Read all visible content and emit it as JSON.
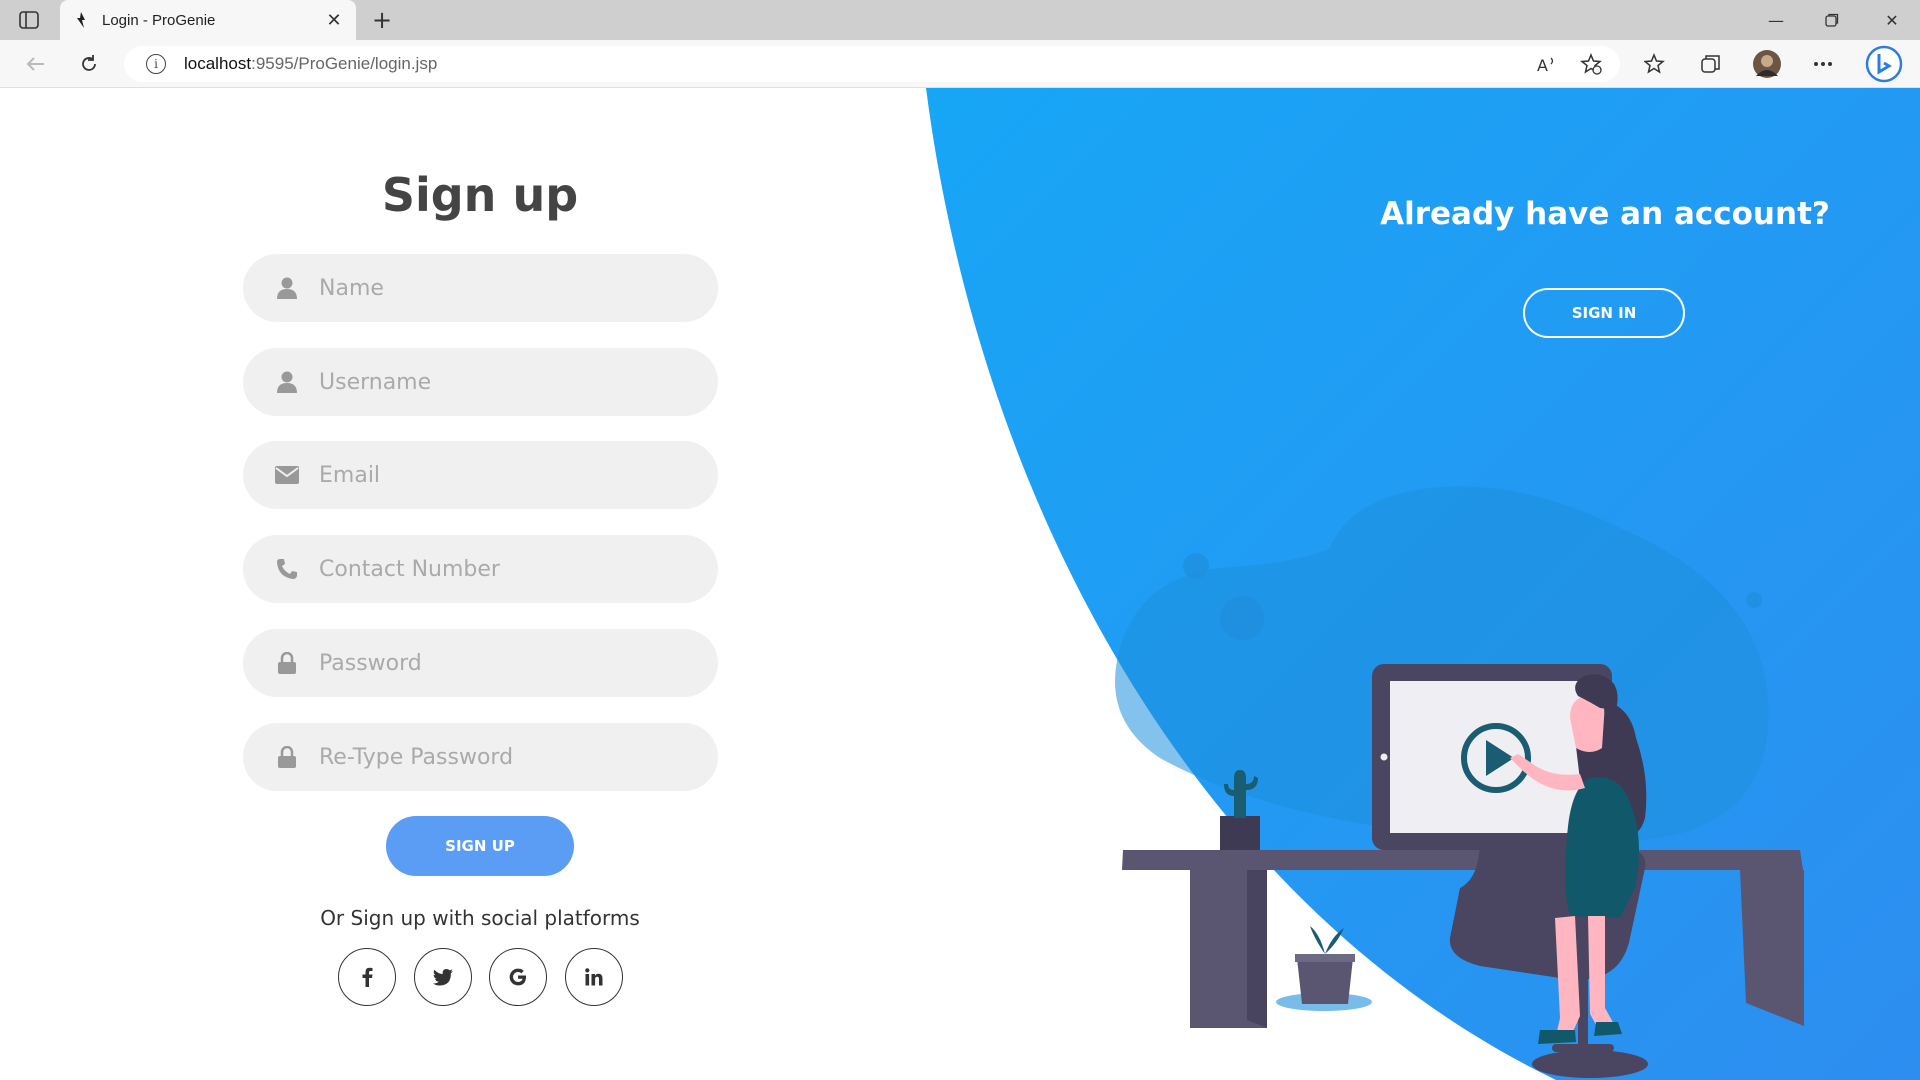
{
  "browser": {
    "tab_title": "Login - ProGenie",
    "url_host": "localhost",
    "url_rest": ":9595/ProGenie/login.jsp"
  },
  "signup": {
    "title": "Sign up",
    "fields": [
      {
        "placeholder": "Name",
        "icon": "user-icon"
      },
      {
        "placeholder": "Username",
        "icon": "user-icon"
      },
      {
        "placeholder": "Email",
        "icon": "envelope-icon"
      },
      {
        "placeholder": "Contact Number",
        "icon": "phone-icon"
      },
      {
        "placeholder": "Password",
        "icon": "lock-icon"
      },
      {
        "placeholder": "Re-Type Password",
        "icon": "lock-icon"
      }
    ],
    "button_label": "SIGN UP",
    "social_text": "Or Sign up with social platforms",
    "social": [
      {
        "label": "f",
        "icon": "facebook-icon"
      },
      {
        "label": "twitter",
        "icon": "twitter-icon"
      },
      {
        "label": "G",
        "icon": "google-icon"
      },
      {
        "label": "in",
        "icon": "linkedin-icon"
      }
    ]
  },
  "signin_panel": {
    "title": "Already have an account?",
    "button_label": "SIGN IN"
  },
  "colors": {
    "accent_blue": "#2196f3",
    "button_blue": "#5b9cf5",
    "field_bg": "#f0f0f0"
  }
}
